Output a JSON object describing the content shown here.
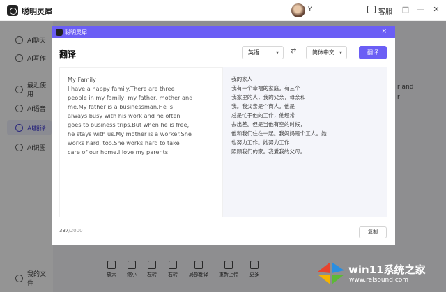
{
  "app": {
    "name": "聪明灵犀",
    "user": "Y",
    "customer_service": "客服"
  },
  "window_controls": [
    "□",
    "—",
    "✕"
  ],
  "sidebar": {
    "items": [
      {
        "label": "AI聊天"
      },
      {
        "label": "AI写作"
      },
      {
        "label": "最近使用"
      },
      {
        "label": "AI语音"
      },
      {
        "label": "AI翻译"
      },
      {
        "label": "AI识图"
      }
    ],
    "footer": "我的文件"
  },
  "background": {
    "right_fragments": [
      "r and",
      "r"
    ],
    "toolbar": [
      "放大",
      "缩小",
      "左转",
      "右转",
      "局部翻译",
      "重新上传",
      "更多"
    ]
  },
  "modal": {
    "header": "聪明灵犀",
    "close": "×",
    "title": "翻译",
    "source_lang": "英语",
    "target_lang": "简体中文",
    "swap": "⇄",
    "translate_button": "翻译",
    "source_text": [
      "My Family",
      "I have a happy family.There are three",
      "people in my family,   my father,   mother and",
      "me.My father is a businessman.He is",
      "always busy with his work and he often",
      "goes to business trips.But when he is free,",
      "he stays with us.My mother is a worker.She",
      "works hard,   too.She works hard to take",
      "care of our home.I love my parents."
    ],
    "translated_text": [
      "我的家人",
      "我有一个幸福的家庭。有三个",
      "我家里的人，我的父亲，母亲和",
      "我。我父亲是个商人。他是",
      "总是忙于他的工作，他经常",
      "去出差。但是当他有空的时候，",
      "他和我们住在一起。我妈妈是个工人。她",
      "也努力工作。她努力工作",
      "照顾我们的家。我爱我的父母。"
    ],
    "char_count": "337",
    "char_limit": "/2000",
    "copy_button": "复制"
  },
  "watermark": {
    "title": "win11系统之家",
    "url": "www.relsound.com"
  }
}
